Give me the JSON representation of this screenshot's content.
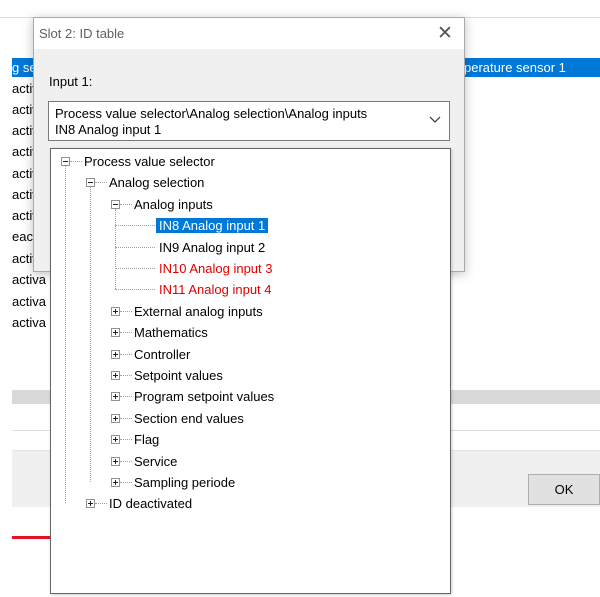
{
  "background": {
    "selected_row_left": "g se",
    "selected_row_right": "perature sensor 1",
    "rows": [
      "activ",
      "activ",
      "activ",
      "activ",
      "activ",
      "activ",
      "activ",
      "eactiva",
      "activa",
      "activa",
      "activa",
      "activa"
    ],
    "ok_label": "OK"
  },
  "dialog": {
    "title": "Slot 2: ID table",
    "input_label": "Input 1:",
    "combo_line1": "Process value selector\\Analog selection\\Analog inputs",
    "combo_line2": "IN8 Analog input 1"
  },
  "tree": [
    {
      "label": "Process value selector",
      "level": 0,
      "toggle": "minus"
    },
    {
      "label": "Analog selection",
      "level": 1,
      "toggle": "minus"
    },
    {
      "label": "Analog inputs",
      "level": 2,
      "toggle": "minus"
    },
    {
      "label": "IN8 Analog input 1",
      "level": 3,
      "toggle": "none",
      "selected": true
    },
    {
      "label": "IN9 Analog input 2",
      "level": 3,
      "toggle": "none"
    },
    {
      "label": "IN10 Analog input 3",
      "level": 3,
      "toggle": "none",
      "color": "#e00000"
    },
    {
      "label": "IN11 Analog input 4",
      "level": 3,
      "toggle": "none",
      "color": "#e00000"
    },
    {
      "label": "External analog inputs",
      "level": 2,
      "toggle": "plus"
    },
    {
      "label": "Mathematics",
      "level": 2,
      "toggle": "plus"
    },
    {
      "label": "Controller",
      "level": 2,
      "toggle": "plus"
    },
    {
      "label": "Setpoint values",
      "level": 2,
      "toggle": "plus"
    },
    {
      "label": "Program setpoint values",
      "level": 2,
      "toggle": "plus"
    },
    {
      "label": "Section end values",
      "level": 2,
      "toggle": "plus"
    },
    {
      "label": "Flag",
      "level": 2,
      "toggle": "plus"
    },
    {
      "label": "Service",
      "level": 2,
      "toggle": "plus"
    },
    {
      "label": "Sampling periode",
      "level": 2,
      "toggle": "plus"
    },
    {
      "label": "ID deactivated",
      "level": 1,
      "toggle": "plus"
    }
  ],
  "colors": {
    "selection": "#0078d7",
    "error_text": "#e00000"
  },
  "icons": {
    "close": "close-icon",
    "combo_arrow": "chevron-down-icon",
    "expand": "plus-box-icon",
    "collapse": "minus-box-icon"
  }
}
